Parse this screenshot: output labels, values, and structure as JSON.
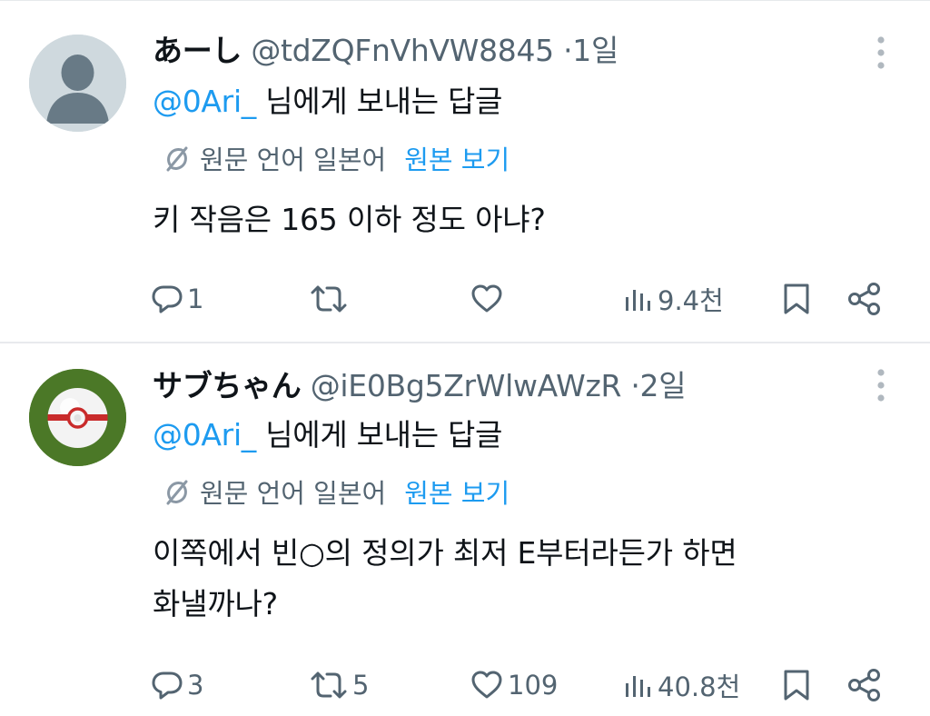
{
  "posts": [
    {
      "name": "あーし",
      "handle": "@tdZQFnVhVW8845",
      "dot": "·",
      "time": "1일",
      "reply_mention": "@0Ari_",
      "reply_suffix": "님에게 보내는 답글",
      "translate_text": "원문 언어 일본어",
      "translate_link": "원본 보기",
      "text_lines": [
        "키 작음은 165 이하 정도 아냐?"
      ],
      "stats": {
        "replies": "1",
        "reposts": "",
        "likes": "",
        "views": "9.4천"
      }
    },
    {
      "name": "サブちゃん",
      "handle": "@iE0Bg5ZrWlwAWzR",
      "dot": "·",
      "time": "2일",
      "reply_mention": "@0Ari_",
      "reply_suffix": "님에게 보내는 답글",
      "translate_text": "원문 언어 일본어",
      "translate_link": "원본 보기",
      "text_lines": [
        "이쪽에서 빈○의 정의가 최저 E부터라든가 하면",
        "화낼까나?"
      ],
      "stats": {
        "replies": "3",
        "reposts": "5",
        "likes": "109",
        "views": "40.8천"
      }
    }
  ],
  "icons": {
    "more": "more-vertical-icon",
    "translate": "translate-icon",
    "reply": "reply-icon",
    "repost": "repost-icon",
    "like": "heart-icon",
    "views": "views-chart-icon",
    "bookmark": "bookmark-icon",
    "share": "share-icon"
  },
  "colors": {
    "link": "#1d9bf0",
    "secondary": "#536471",
    "text": "#0f1419"
  }
}
